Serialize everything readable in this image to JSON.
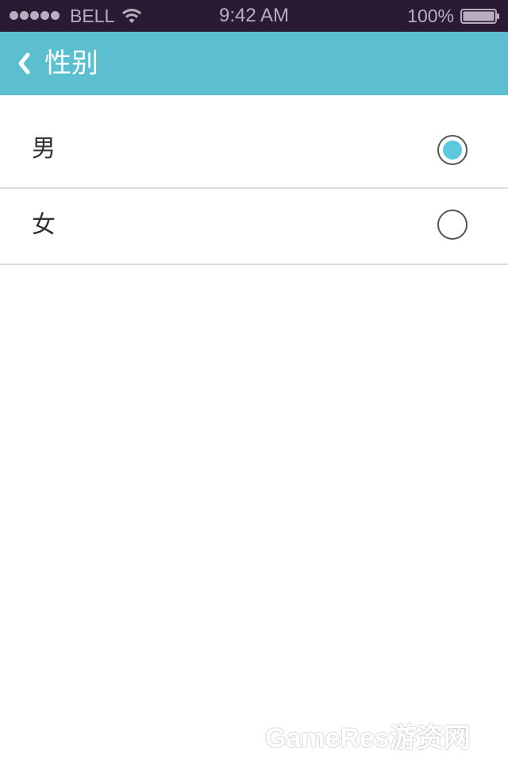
{
  "status_bar": {
    "carrier": "BELL",
    "time": "9:42 AM",
    "battery": "100%",
    "signal_icon": "signal-dots-icon",
    "wifi_icon": "wifi-icon",
    "battery_icon": "battery-icon"
  },
  "nav": {
    "title": "性别",
    "back_icon": "chevron-left-icon"
  },
  "options": [
    {
      "label": "男",
      "selected": true
    },
    {
      "label": "女",
      "selected": false
    }
  ],
  "watermark": "GameRes游资网",
  "colors": {
    "status_bar_bg": "#2a1a33",
    "nav_bg": "#5bbfcf",
    "radio_selected": "#5bc8dc"
  }
}
